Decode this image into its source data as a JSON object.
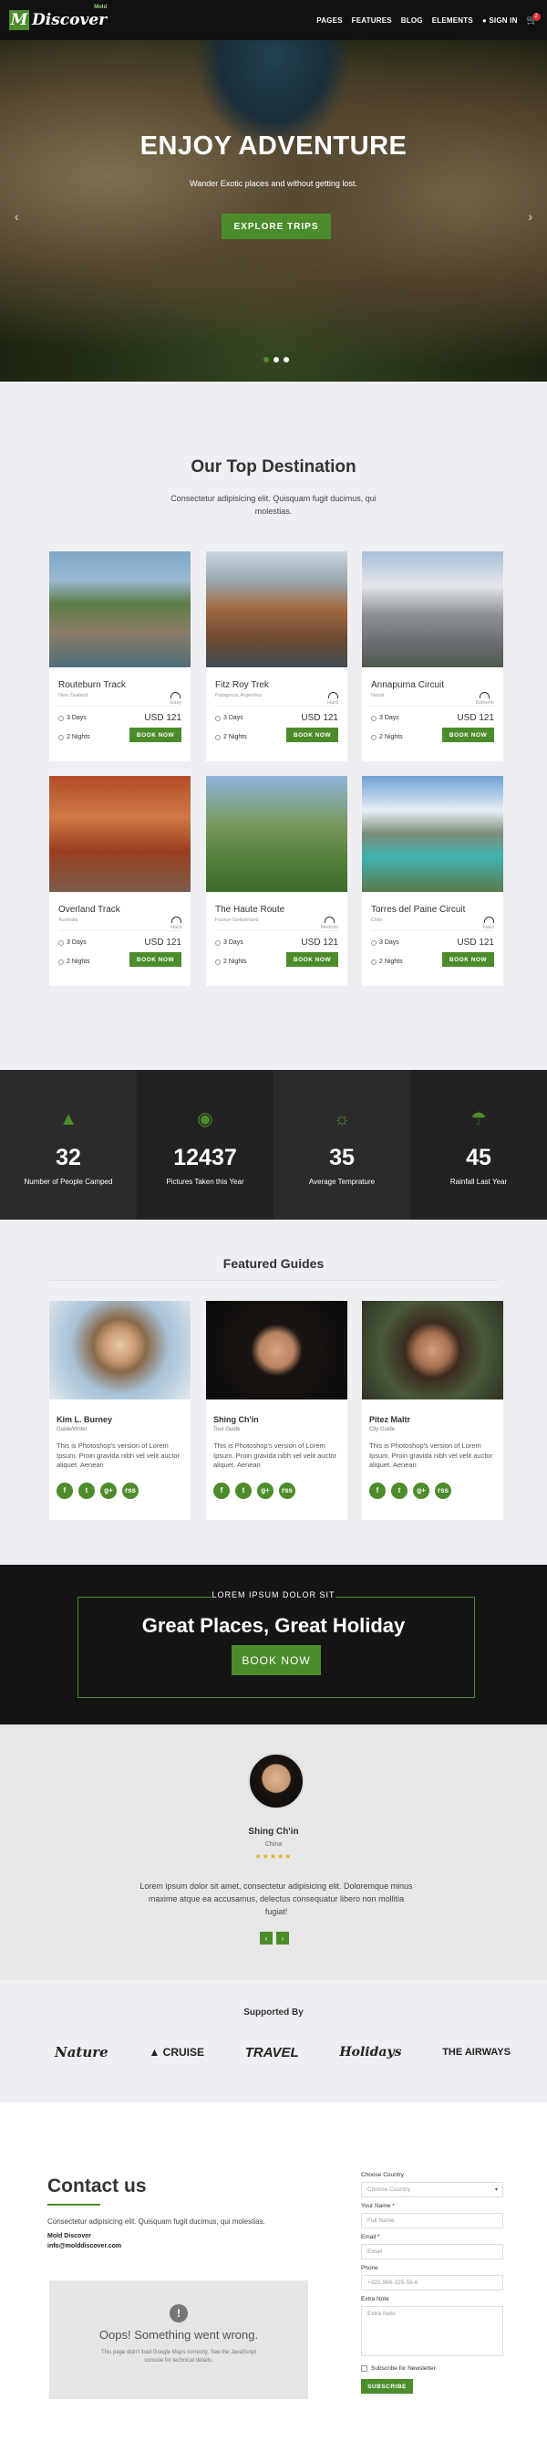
{
  "nav": {
    "logo_badge": "M",
    "logo_text": "Discover",
    "logo_sup": "Mold",
    "items": [
      "PAGES",
      "FEATURES",
      "BLOG",
      "ELEMENTS"
    ],
    "signin": "SIGN IN",
    "cart_count": "2"
  },
  "hero": {
    "title": "ENJOY ADVENTURE",
    "subtitle": "Wander Exotic places and without getting lost.",
    "button": "EXPLORE TRIPS"
  },
  "destinations": {
    "title": "Our Top Destination",
    "description": "Consectetur adipisicing elit. Quisquam fugit ducimus, qui molestias.",
    "book_label": "BOOK NOW",
    "cards": [
      {
        "name": "Routeburn Track",
        "region": "New Zealand",
        "difficulty": "Easy",
        "days": "3 Days",
        "nights": "2 Nights",
        "price": "USD 121"
      },
      {
        "name": "Fitz Roy Trek",
        "region": "Patagonia, Argentina",
        "difficulty": "Hard",
        "days": "3 Days",
        "nights": "2 Nights",
        "price": "USD 121"
      },
      {
        "name": "Annapurna Circuit",
        "region": "Nepal",
        "difficulty": "Extreme",
        "days": "3 Days",
        "nights": "2 Nights",
        "price": "USD 121"
      },
      {
        "name": "Overland Track",
        "region": "Australia",
        "difficulty": "Hard",
        "days": "3 Days",
        "nights": "2 Nights",
        "price": "USD 121"
      },
      {
        "name": "The Haute Route",
        "region": "France-Switzerland",
        "difficulty": "Medium",
        "days": "3 Days",
        "nights": "2 Nights",
        "price": "USD 121"
      },
      {
        "name": "Torres del Paine Circuit",
        "region": "Chile",
        "difficulty": "Hard",
        "days": "3 Days",
        "nights": "2 Nights",
        "price": "USD 121"
      }
    ]
  },
  "stats": [
    {
      "icon": "tent-icon",
      "value": "32",
      "label": "Number of People Camped"
    },
    {
      "icon": "camera-icon",
      "value": "12437",
      "label": "Pictures Taken this Year"
    },
    {
      "icon": "sun-icon",
      "value": "35",
      "label": "Average Temprature"
    },
    {
      "icon": "umbrella-icon",
      "value": "45",
      "label": "Rainfall Last Year"
    }
  ],
  "guides": {
    "title": "Featured Guides",
    "items": [
      {
        "name": "Kim L. Burney",
        "role": "Guide/Writer",
        "text": "This is Photoshop's version of Lorem Ipsum. Proin gravida nibh vel velit auctor aliquet. Aenean"
      },
      {
        "name": "Shing Ch'in",
        "role": "Tour Guide",
        "text": "This is Photoshop's version of Lorem Ipsum. Proin gravida nibh vel velit auctor aliquet. Aenean"
      },
      {
        "name": "Pitez Maltr",
        "role": "City Guide",
        "text": "This is Photoshop's version of Lorem Ipsum. Proin gravida nibh vel velit auctor aliquet. Aenean"
      }
    ],
    "social_glyphs": [
      "f",
      "t",
      "g+",
      "rss"
    ]
  },
  "promo": {
    "tag": "LOREM IPSUM DOLOR SIT",
    "title": "Great Places, Great Holiday",
    "button": "BOOK NOW"
  },
  "testimonial": {
    "name": "Shing Ch'in",
    "location": "China",
    "stars": "★★★★★",
    "quote": "Lorem ipsum dolor sit amet, consectetur adipisicing elit. Doloremque minus maxime atque ea accusamus, delectus consequatur libero non mollitia fugiat!"
  },
  "supported": {
    "title": "Supported By",
    "brands": [
      "Nature",
      "CRUISE",
      "TRAVEL",
      "Holidays",
      "THE AIRWAYS"
    ]
  },
  "contact": {
    "title": "Contact us",
    "description": "Consectetur adipisicing elit. Quisquam fugit ducimus, qui molestias.",
    "company": "Mold Discover",
    "email": "info@molddiscover.com",
    "map_error_title": "Oops! Something went wrong.",
    "map_error_text": "This page didn't load Google Maps correctly. See the JavaScript console for technical details.",
    "form": {
      "country_label": "Choose Country",
      "country_value": "Choose Country",
      "name_label": "Your Name *",
      "name_placeholder": "Full Name",
      "email_label": "Email *",
      "email_placeholder": "Email",
      "phone_label": "Phone",
      "phone_placeholder": "+321 986-325-55-6",
      "note_label": "Extra Note",
      "note_placeholder": "Extra Note",
      "newsletter": "Subscribe for Newsletter",
      "submit": "SUBSCRIBE"
    }
  },
  "colors": {
    "accent": "#4c8c2b",
    "dark": "#151515",
    "light_bg": "#eeeff3"
  }
}
